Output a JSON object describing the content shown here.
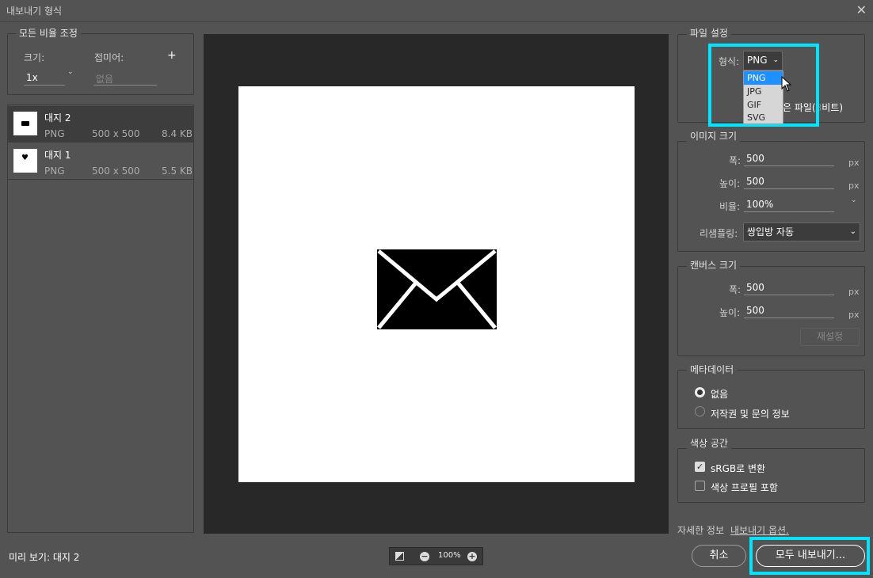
{
  "window": {
    "title": "내보내기 형식"
  },
  "scale_section": {
    "legend": "모든 비율 조정",
    "size_label": "크기:",
    "suffix_label": "접미어:",
    "add_icon": "+",
    "size_value": "1x",
    "suffix_placeholder": "없음"
  },
  "artboards": [
    {
      "name": "대지 2",
      "format": "PNG",
      "dims": "500 x 500",
      "size": "8.4 KB",
      "icon": "envelope-icon"
    },
    {
      "name": "대지 1",
      "format": "PNG",
      "dims": "500 x 500",
      "size": "5.5 KB",
      "icon": "heart-icon"
    }
  ],
  "preview": {
    "label": "미리 보기: 대지 2",
    "zoom": "100%"
  },
  "file_settings": {
    "legend": "파일 설정",
    "format_label": "형식:",
    "format_value": "PNG",
    "format_options": [
      "PNG",
      "JPG",
      "GIF",
      "SVG"
    ],
    "hidden_text": "은 파일(",
    "hidden_text2": "비트)"
  },
  "image_size": {
    "legend": "이미지 크기",
    "width_label": "폭:",
    "width": "500",
    "height_label": "높이:",
    "height": "500",
    "scale_label": "비율:",
    "scale": "100%",
    "resample_label": "리샘플링:",
    "resample": "쌍입방 자동",
    "unit": "px"
  },
  "canvas_size": {
    "legend": "캔버스 크기",
    "width_label": "폭:",
    "width": "500",
    "height_label": "높이:",
    "height": "500",
    "unit": "px",
    "reset": "재설정"
  },
  "metadata": {
    "legend": "메타데이터",
    "opt_none": "없음",
    "opt_copyright": "저작권 및 문의 정보"
  },
  "color_space": {
    "legend": "색상 공간",
    "srgb": "sRGB로 변환",
    "embed": "색상 프로필 포함"
  },
  "footer": {
    "more_info": "자세한 정보",
    "export_options": "내보내기 옵션.",
    "cancel": "취소",
    "export_all": "모두 내보내기..."
  },
  "colors": {
    "highlight": "#00e5ff",
    "accent": "#1e90ff"
  }
}
